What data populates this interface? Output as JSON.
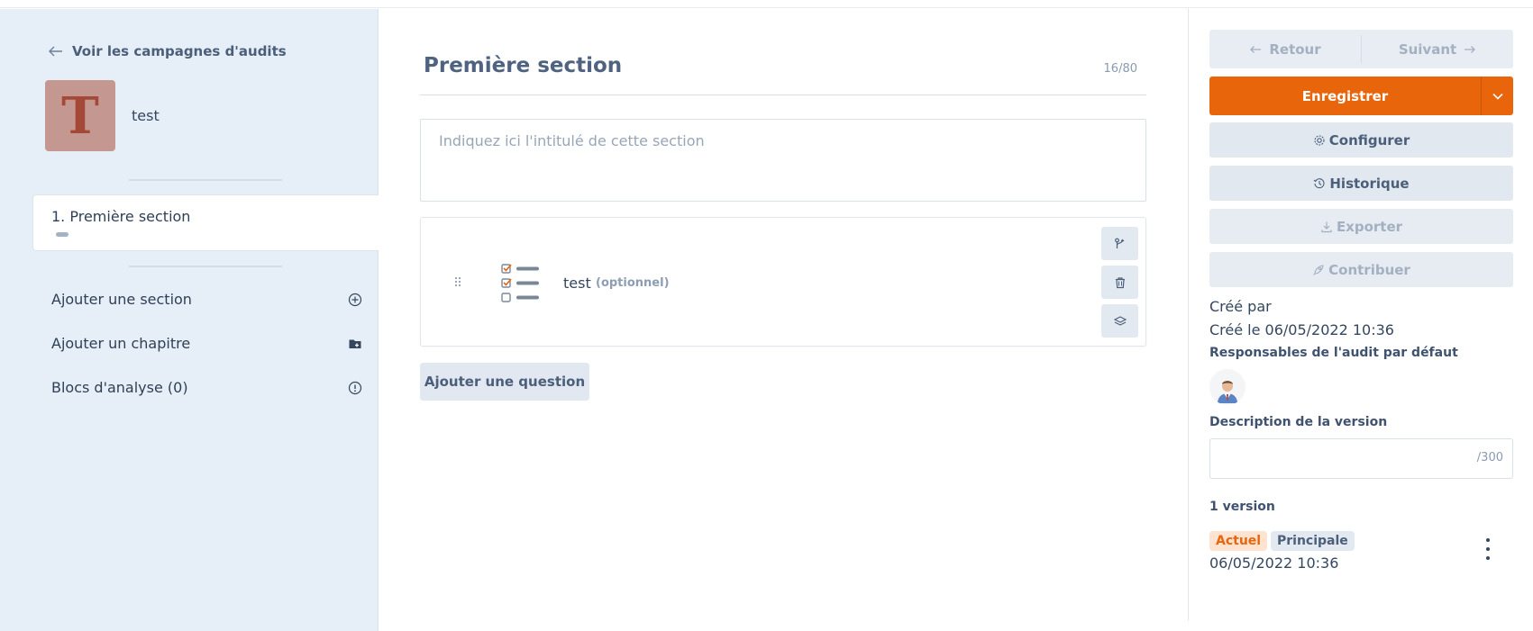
{
  "sidebar": {
    "back_label": "Voir les campagnes d'audits",
    "avatar_letter": "T",
    "audit_name": "test",
    "sections": [
      {
        "label": "1. Première section"
      }
    ],
    "actions": [
      {
        "label": "Ajouter une section",
        "icon": "plus-circle-icon"
      },
      {
        "label": "Ajouter un chapitre",
        "icon": "folder-plus-icon"
      },
      {
        "label": "Blocs d'analyse (0)",
        "icon": "info-circle-icon"
      }
    ]
  },
  "main": {
    "section_title": "Première section",
    "title_counter": "16/80",
    "description_placeholder": "Indiquez ici l'intitulé de cette section",
    "question": {
      "label": "test",
      "optional": "(optionnel)"
    },
    "add_question_label": "Ajouter une question"
  },
  "right_panel": {
    "back_label": "Retour",
    "next_label": "Suivant",
    "save_label": "Enregistrer",
    "configure_label": "Configurer",
    "history_label": "Historique",
    "export_label": "Exporter",
    "contribute_label": "Contribuer",
    "created_by": "Créé par",
    "created_on": "Créé le 06/05/2022 10:36",
    "owners_heading": "Responsables de l'audit par défaut",
    "version_desc_heading": "Description de la version",
    "version_desc_counter": "/300",
    "versions_count": "1 version",
    "version": {
      "badge_current": "Actuel",
      "badge_main": "Principale",
      "date": "06/05/2022 10:36"
    }
  },
  "colors": {
    "accent": "#e9650b",
    "sidebar_bg": "#e6eef7",
    "avatar_bg": "#c49891",
    "avatar_letter": "#a44837"
  }
}
